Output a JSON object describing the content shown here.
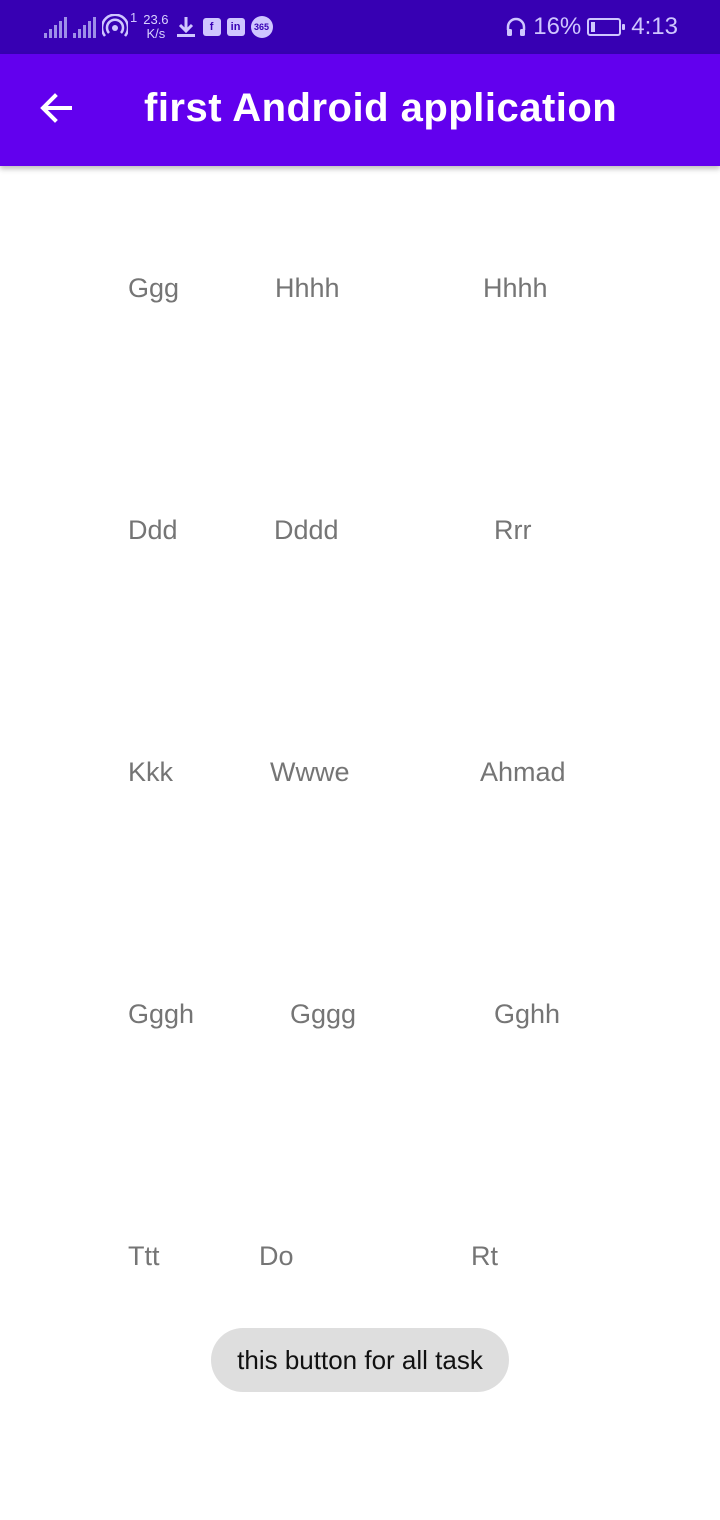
{
  "status_bar": {
    "speed_value": "23.6",
    "speed_unit": "K/s",
    "notif_badge": "1",
    "battery": "16%",
    "battery_level": 0.16,
    "time": "4:13",
    "icons": [
      "signal-icon",
      "signal-icon",
      "hotspot-icon",
      "download-icon",
      "facebook-icon",
      "linkedin-icon",
      "app-365-icon",
      "headphones-icon",
      "battery-icon"
    ]
  },
  "app_bar": {
    "title": "first Android application",
    "back_icon": "arrow-left-icon",
    "color": "#6200ee"
  },
  "grid": {
    "rows": [
      [
        "Ggg",
        "Hhhh",
        "Hhhh"
      ],
      [
        "Ddd",
        "Dddd",
        "Rrr"
      ],
      [
        "Kkk",
        "Wwwe",
        "Ahmad"
      ],
      [
        "Gggh",
        "Gggg",
        "Gghh"
      ],
      [
        "Ttt",
        "Do",
        "Rt"
      ]
    ]
  },
  "button": {
    "label": "this button for all task"
  }
}
